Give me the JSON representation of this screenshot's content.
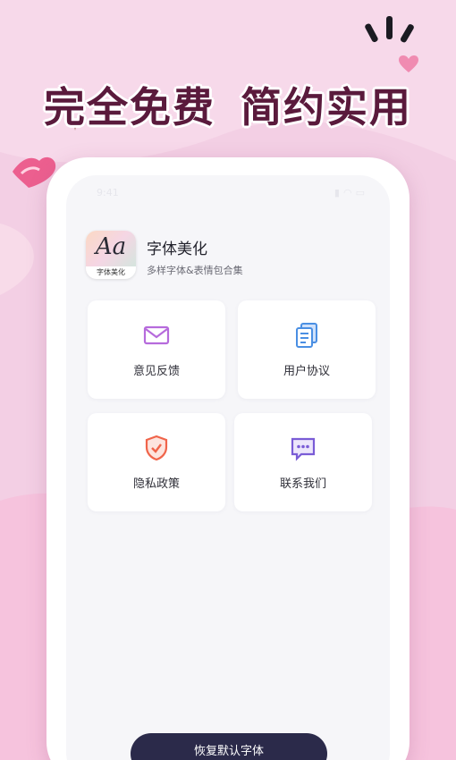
{
  "promo": {
    "headline_left": "完全免费",
    "headline_right": "简约实用"
  },
  "status_bar": {
    "time": "9:41",
    "icons": [
      "signal-icon",
      "wifi-icon",
      "battery-icon"
    ]
  },
  "app": {
    "icon_glyph": "Aa",
    "icon_label": "字体美化",
    "title": "字体美化",
    "subtitle": "多样字体&表情包合集"
  },
  "menu": [
    {
      "label": "意见反馈",
      "icon": "mail-icon",
      "color": "#b66bdc"
    },
    {
      "label": "用户协议",
      "icon": "document-icon",
      "color": "#4a8fe3"
    },
    {
      "label": "隐私政策",
      "icon": "shield-icon",
      "color": "#f0644a"
    },
    {
      "label": "联系我们",
      "icon": "chat-icon",
      "color": "#7a5cd6"
    }
  ],
  "restore_button": {
    "label": "恢复默认字体"
  },
  "colors": {
    "background": "#f3cfe4",
    "headline": "#5a1a3c",
    "button": "#2b2a4a"
  }
}
